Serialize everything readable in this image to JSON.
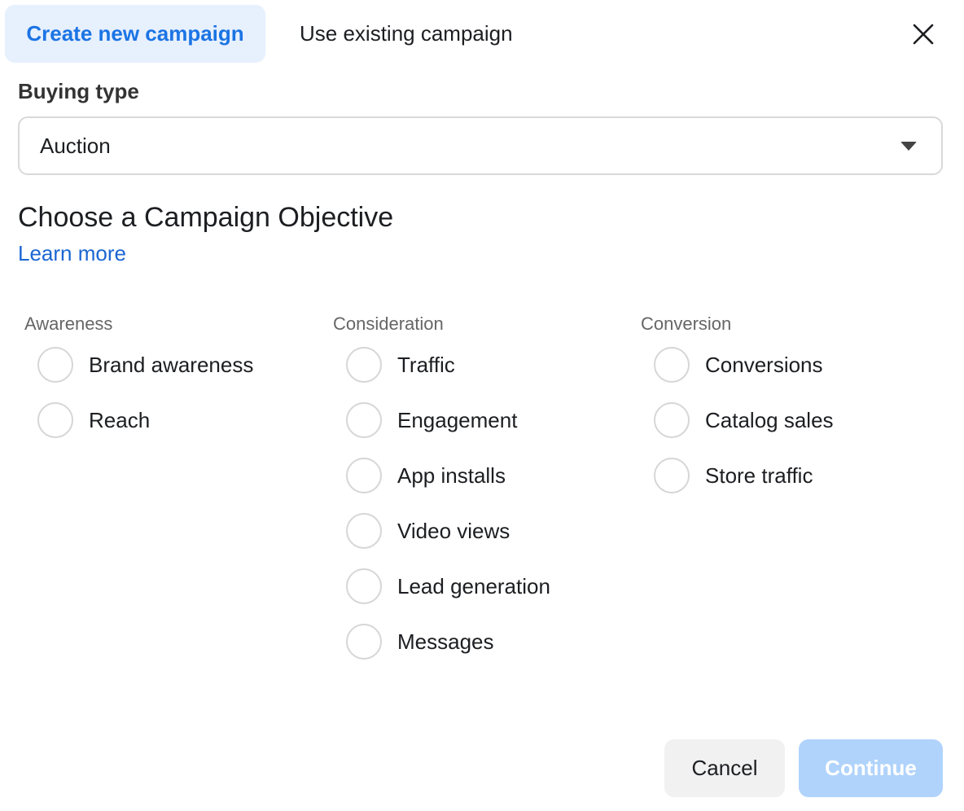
{
  "tabs": [
    {
      "label": "Create new campaign",
      "active": true
    },
    {
      "label": "Use existing campaign",
      "active": false
    }
  ],
  "buying_type": {
    "label": "Buying type",
    "selected": "Auction"
  },
  "objective": {
    "heading": "Choose a Campaign Objective",
    "learn_more": "Learn more",
    "groups": [
      {
        "title": "Awareness",
        "options": [
          "Brand awareness",
          "Reach"
        ]
      },
      {
        "title": "Consideration",
        "options": [
          "Traffic",
          "Engagement",
          "App installs",
          "Video views",
          "Lead generation",
          "Messages"
        ]
      },
      {
        "title": "Conversion",
        "options": [
          "Conversions",
          "Catalog sales",
          "Store traffic"
        ]
      }
    ]
  },
  "footer": {
    "cancel_label": "Cancel",
    "continue_label": "Continue"
  },
  "colors": {
    "accent": "#1b74e4",
    "active_tab_bg": "#e7f0fd",
    "continue_disabled_bg": "#b0d3fc"
  }
}
